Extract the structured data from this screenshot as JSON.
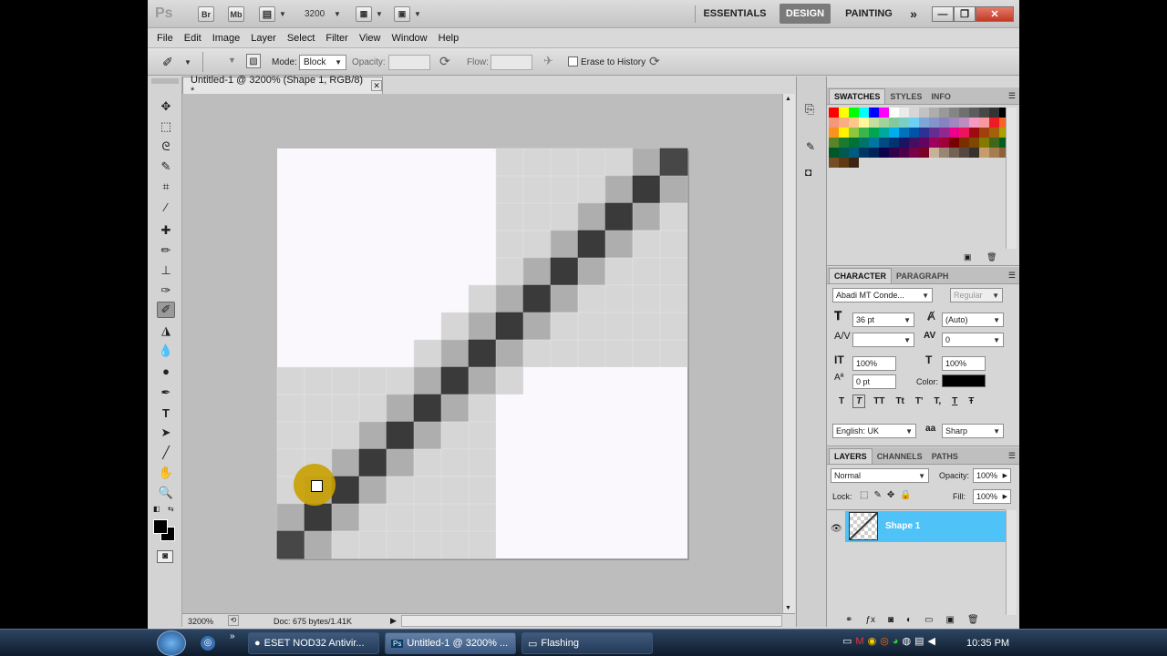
{
  "title_bar": {
    "app_logo": "Ps",
    "bridge_btn": "Br",
    "minibridge_btn": "Mb",
    "zoom_value": "3200",
    "workspaces": [
      "ESSENTIALS",
      "DESIGN",
      "PAINTING"
    ],
    "active_workspace": "DESIGN",
    "more": "»"
  },
  "menu": [
    "File",
    "Edit",
    "Image",
    "Layer",
    "Select",
    "Filter",
    "View",
    "Window",
    "Help"
  ],
  "options_bar": {
    "mode_label": "Mode:",
    "mode_value": "Block",
    "opacity_label": "Opacity:",
    "flow_label": "Flow:",
    "erase_history_label": "Erase to History"
  },
  "document": {
    "tab_title": "Untitled-1 @ 3200% (Shape 1, RGB/8) *",
    "zoom": "3200%",
    "doc_info": "Doc: 675 bytes/1.41K"
  },
  "swatches_panel": {
    "tabs": [
      "SWATCHES",
      "STYLES",
      "INFO"
    ],
    "active_tab": "SWATCHES"
  },
  "character_panel": {
    "tabs": [
      "CHARACTER",
      "PARAGRAPH"
    ],
    "font_family": "Abadi MT Conde...",
    "font_style": "Regular",
    "font_size": "36 pt",
    "leading": "(Auto)",
    "tracking": "0",
    "vertical_scale": "100%",
    "horizontal_scale": "100%",
    "baseline_shift": "0 pt",
    "color_label": "Color:",
    "type_buttons": [
      "T",
      "T",
      "TT",
      "Tt",
      "T'",
      "T,",
      "T",
      "Ŧ"
    ],
    "language": "English: UK",
    "aa_label": "a",
    "antialias": "Sharp"
  },
  "layers_panel": {
    "tabs": [
      "LAYERS",
      "CHANNELS",
      "PATHS"
    ],
    "blend_mode": "Normal",
    "opacity_label": "Opacity:",
    "opacity_value": "100%",
    "lock_label": "Lock:",
    "fill_label": "Fill:",
    "fill_value": "100%",
    "layer_name": "Shape 1"
  },
  "taskbar": {
    "tasks": [
      "ESET NOD32 Antivir...",
      "Untitled-1 @ 3200% ...",
      "Flashing"
    ],
    "clock": "10:35 PM"
  },
  "colors": {
    "accent_layer": "#4fc3f7",
    "design_tab": "#7a7a7a",
    "cursor_highlight": "#c9a000"
  }
}
